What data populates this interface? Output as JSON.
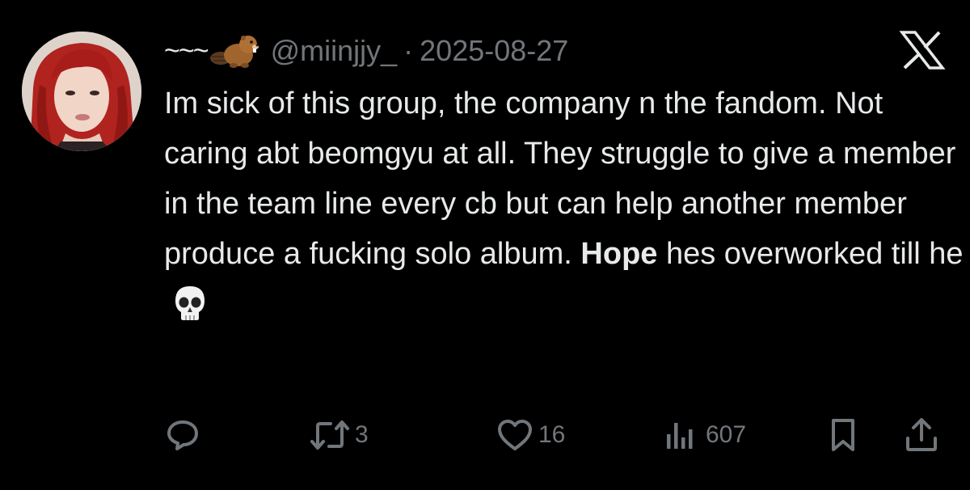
{
  "tweet": {
    "display_name": "~~~",
    "handle": "@miinjjy_",
    "separator": "·",
    "date": "2025-08-27",
    "text_part_1": "Im sick of this group, the company n the fandom. Not caring abt beomgyu at all. They struggle to give a member in the team line every cb but can help another member produce a fucking solo album.",
    "text_bold": "Hope",
    "text_part_2": "hes overworked till he"
  },
  "icons": {
    "name_emoji": "beaver-icon",
    "end_emoji": "skull-icon",
    "brand": "x-logo-icon",
    "reply": "reply-icon",
    "retweet": "retweet-icon",
    "like": "heart-icon",
    "views": "views-icon",
    "bookmark": "bookmark-icon",
    "share": "share-icon"
  },
  "metrics": {
    "retweets": "3",
    "likes": "16",
    "views": "607"
  },
  "colors": {
    "background": "#000000",
    "text": "#e7e9ea",
    "secondary": "#71767b"
  }
}
